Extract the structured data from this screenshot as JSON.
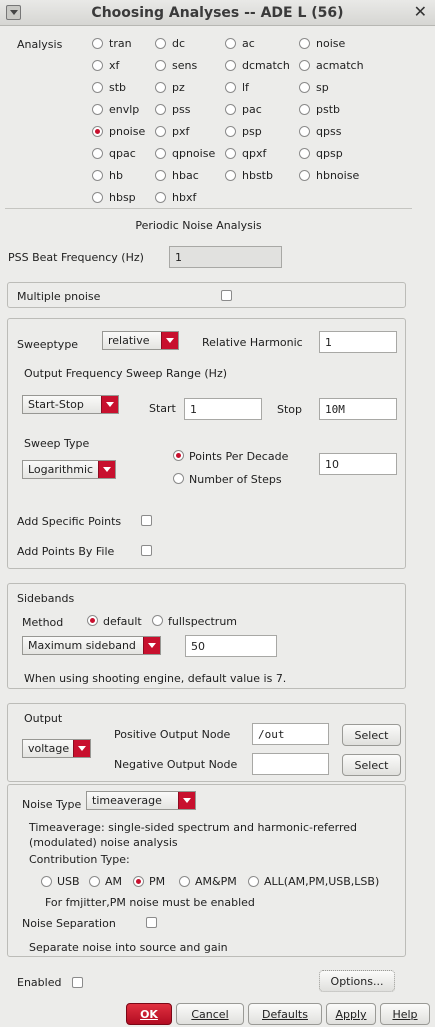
{
  "window": {
    "title": "Choosing Analyses -- ADE L (56)"
  },
  "analysis": {
    "label": "Analysis",
    "options": [
      [
        "tran",
        "dc",
        "ac",
        "noise"
      ],
      [
        "xf",
        "sens",
        "dcmatch",
        "acmatch"
      ],
      [
        "stb",
        "pz",
        "lf",
        "sp"
      ],
      [
        "envlp",
        "pss",
        "pac",
        "pstb"
      ],
      [
        "pnoise",
        "pxf",
        "psp",
        "qpss"
      ],
      [
        "qpac",
        "qpnoise",
        "qpxf",
        "qpsp"
      ],
      [
        "hb",
        "hbac",
        "hbstb",
        "hbnoise"
      ],
      [
        "hbsp",
        "hbxf"
      ]
    ],
    "selected": "pnoise"
  },
  "section_title": "Periodic Noise Analysis",
  "pss_beat": {
    "label": "PSS Beat Frequency (Hz)",
    "value": "1"
  },
  "multiple_pnoise": {
    "label": "Multiple pnoise",
    "checked": false
  },
  "sweep": {
    "sweeptype_label": "Sweeptype",
    "sweeptype_value": "relative",
    "rel_harmonic_label": "Relative Harmonic",
    "rel_harmonic_value": "1",
    "range_label": "Output Frequency Sweep Range (Hz)",
    "range_mode": "Start-Stop",
    "start_label": "Start",
    "start_value": "1",
    "stop_label": "Stop",
    "stop_value": "10M",
    "sweep_type_label": "Sweep Type",
    "sweep_type_value": "Logarithmic",
    "ppd_label": "Points Per Decade",
    "nsteps_label": "Number of Steps",
    "points_selected": "Points Per Decade",
    "ppd_value": "10",
    "add_specific_label": "Add Specific Points",
    "add_by_file_label": "Add Points By File"
  },
  "sidebands": {
    "title": "Sidebands",
    "method_label": "Method",
    "default_label": "default",
    "full_label": "fullspectrum",
    "method_selected": "default",
    "max_label": "Maximum sideband",
    "max_value": "50",
    "note": "When using shooting engine, default value is 7."
  },
  "output": {
    "title": "Output",
    "mode": "voltage",
    "pos_label": "Positive Output Node",
    "pos_value": "/out",
    "neg_label": "Negative Output Node",
    "neg_value": "",
    "select_label": "Select"
  },
  "noise": {
    "type_label": "Noise Type",
    "type_value": "timeaverage",
    "desc_line1": "Timeaverage: single-sided spectrum and harmonic-referred",
    "desc_line2": "(modulated) noise analysis",
    "contrib_label": "Contribution Type:",
    "contrib_options": [
      "USB",
      "AM",
      "PM",
      "AM&PM",
      "ALL(AM,PM,USB,LSB)"
    ],
    "contrib_selected": "PM",
    "fmjitter_note": "For fmjitter,PM noise must be enabled",
    "separation_label": "Noise Separation",
    "separation_note": "Separate noise into source and gain"
  },
  "footer": {
    "enabled_label": "Enabled",
    "options_label": "Options...",
    "ok_label": "OK",
    "cancel_label": "Cancel",
    "defaults_label": "Defaults",
    "apply_label": "Apply",
    "help_label": "Help"
  },
  "colors": {
    "accent": "#c8102e",
    "background": "#ececea"
  }
}
